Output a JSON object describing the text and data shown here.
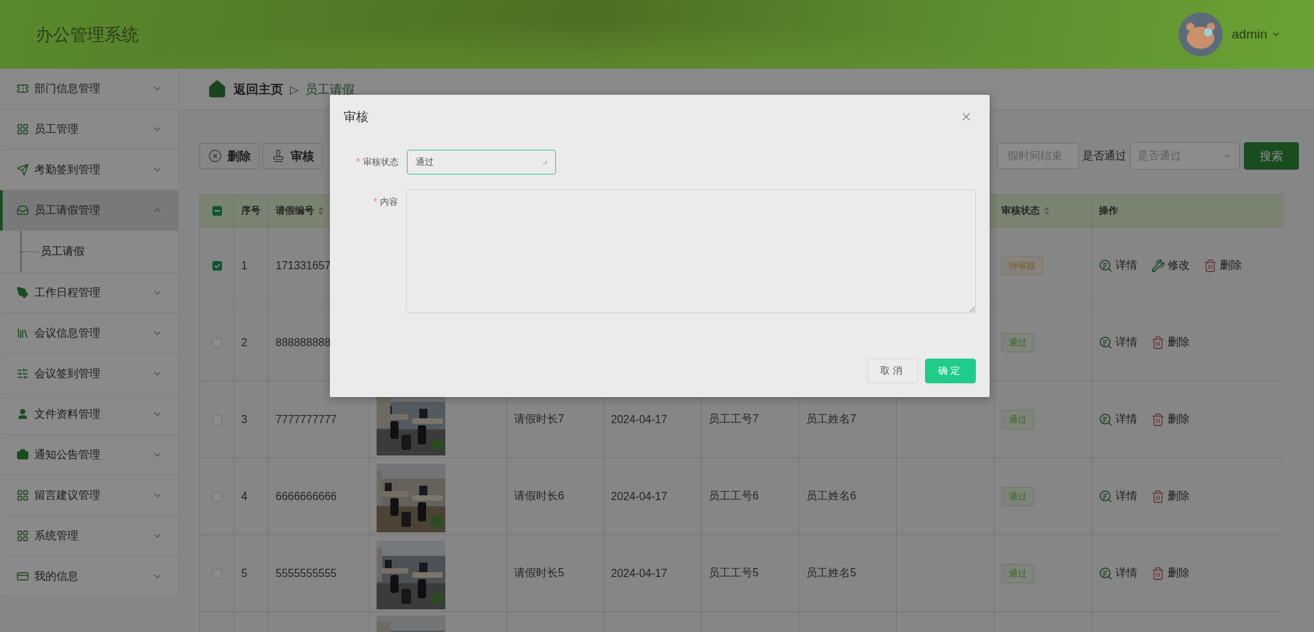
{
  "header": {
    "title": "办公管理系统",
    "user": "admin"
  },
  "sidebar": {
    "items": [
      {
        "label": "部门信息管理",
        "active": false,
        "expanded": false
      },
      {
        "label": "员工管理",
        "active": false,
        "expanded": false
      },
      {
        "label": "考勤签到管理",
        "active": false,
        "expanded": false
      },
      {
        "label": "员工请假管理",
        "active": true,
        "expanded": true,
        "children": [
          {
            "label": "员工请假"
          }
        ]
      },
      {
        "label": "工作日程管理",
        "active": false,
        "expanded": false
      },
      {
        "label": "会议信息管理",
        "active": false,
        "expanded": false
      },
      {
        "label": "会议签到管理",
        "active": false,
        "expanded": false
      },
      {
        "label": "文件资料管理",
        "active": false,
        "expanded": false
      },
      {
        "label": "通知公告管理",
        "active": false,
        "expanded": false
      },
      {
        "label": "留言建议管理",
        "active": false,
        "expanded": false
      },
      {
        "label": "系统管理",
        "active": false,
        "expanded": false
      },
      {
        "label": "我的信息",
        "active": false,
        "expanded": false
      }
    ]
  },
  "breadcrumb": {
    "home": "返回主页",
    "separator": "▷",
    "current": "员工请假"
  },
  "toolbar": {
    "buttons": [
      {
        "label": "删除",
        "kind": "delete"
      },
      {
        "label": "审核",
        "kind": "review"
      }
    ],
    "end_date": {
      "placeholder": "假时间结束"
    },
    "passed": {
      "label": "是否通过",
      "placeholder": "是否通过"
    },
    "search_button": "搜索"
  },
  "table": {
    "select_all": {
      "indeterminate": true
    },
    "columns": [
      {
        "label": "序号",
        "sortable": false
      },
      {
        "label": "请假编号",
        "sortable": true
      },
      {
        "label": "审核状态",
        "sortable": true
      },
      {
        "label": "操作",
        "sortable": false
      }
    ],
    "rows": [
      {
        "selected": true,
        "index": "1",
        "code": "171331657",
        "status": {
          "label": "待审核",
          "kind": "pending"
        },
        "actions": [
          {
            "label": "详情",
            "kind": "detail"
          },
          {
            "label": "修改",
            "kind": "edit"
          },
          {
            "label": "删除",
            "kind": "delete"
          }
        ]
      },
      {
        "selected": false,
        "index": "2",
        "code": "888888888",
        "status": {
          "label": "通过",
          "kind": "approved"
        },
        "actions": [
          {
            "label": "详情",
            "kind": "detail"
          },
          {
            "label": "删除",
            "kind": "delete"
          }
        ]
      },
      {
        "selected": false,
        "index": "3",
        "code": "7777777777",
        "photo": {
          "kind": "picture"
        },
        "duration": "请假时长7",
        "date": "2024-04-17",
        "empno": "员工工号7",
        "name": "员工姓名7",
        "status": {
          "label": "通过",
          "kind": "approved"
        },
        "actions": [
          {
            "label": "详情",
            "kind": "detail"
          },
          {
            "label": "删除",
            "kind": "delete"
          }
        ]
      },
      {
        "selected": false,
        "index": "4",
        "code": "6666666666",
        "photo": {
          "kind": "picture"
        },
        "duration": "请假时长6",
        "date": "2024-04-17",
        "empno": "员工工号6",
        "name": "员工姓名6",
        "status": {
          "label": "通过",
          "kind": "approved"
        },
        "actions": [
          {
            "label": "详情",
            "kind": "detail"
          },
          {
            "label": "删除",
            "kind": "delete"
          }
        ]
      },
      {
        "selected": false,
        "index": "5",
        "code": "5555555555",
        "photo": {
          "kind": "picture"
        },
        "duration": "请假时长5",
        "date": "2024-04-17",
        "empno": "员工工号5",
        "name": "员工姓名5",
        "status": {
          "label": "通过",
          "kind": "approved"
        },
        "actions": [
          {
            "label": "详情",
            "kind": "detail"
          },
          {
            "label": "删除",
            "kind": "delete"
          }
        ]
      },
      {
        "photo": {
          "kind": "picture"
        }
      }
    ]
  },
  "dialog": {
    "title": "审核",
    "fields": [
      {
        "label": "审核状态",
        "required_mark": "*",
        "kind": "select",
        "value": "通过"
      },
      {
        "label": "内容",
        "required_mark": "*",
        "kind": "textarea"
      }
    ],
    "buttons": [
      {
        "label": "取消",
        "kind": "secondary"
      },
      {
        "label": "确定",
        "kind": "primary"
      }
    ]
  }
}
